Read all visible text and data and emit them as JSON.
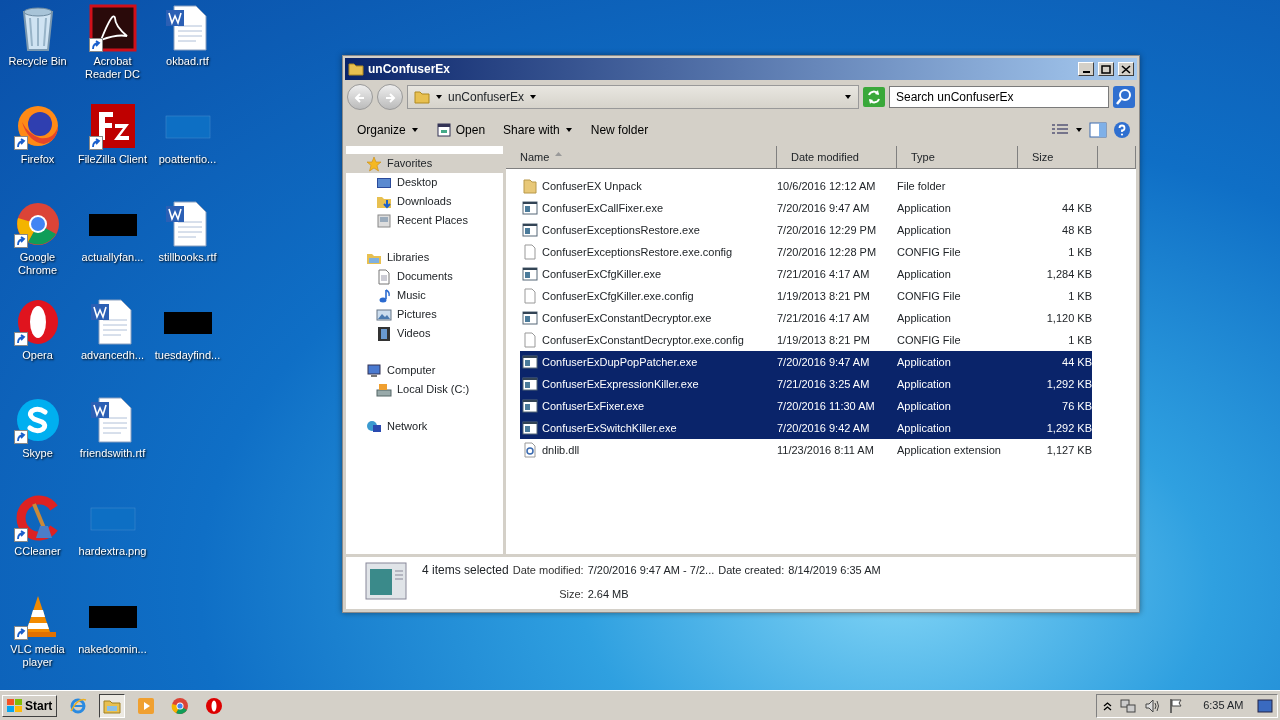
{
  "desktop": {
    "icons": [
      {
        "label": "Recycle Bin",
        "kind": "recycle",
        "shortcut": false
      },
      {
        "label": "Firefox",
        "kind": "firefox",
        "shortcut": true
      },
      {
        "label": "Google Chrome",
        "kind": "chrome",
        "shortcut": true
      },
      {
        "label": "Opera",
        "kind": "opera",
        "shortcut": true
      },
      {
        "label": "Skype",
        "kind": "skype",
        "shortcut": true
      },
      {
        "label": "CCleaner",
        "kind": "ccleaner",
        "shortcut": true
      },
      {
        "label": "VLC media player",
        "kind": "vlc",
        "shortcut": true
      },
      {
        "label": "Acrobat Reader DC",
        "kind": "acrobat",
        "shortcut": true
      },
      {
        "label": "FileZilla Client",
        "kind": "filezilla",
        "shortcut": true
      },
      {
        "label": "actuallyfan...",
        "kind": "dark-thumb",
        "shortcut": false
      },
      {
        "label": "advancedh...",
        "kind": "word",
        "shortcut": false
      },
      {
        "label": "friendswith.rtf",
        "kind": "word",
        "shortcut": false
      },
      {
        "label": "hardextra.png",
        "kind": "blank-thumb",
        "shortcut": false
      },
      {
        "label": "nakedcomin...",
        "kind": "dark-thumb",
        "shortcut": false
      },
      {
        "label": "okbad.rtf",
        "kind": "word",
        "shortcut": false
      },
      {
        "label": "poattentio...",
        "kind": "blank-thumb",
        "shortcut": false
      },
      {
        "label": "stillbooks.rtf",
        "kind": "word",
        "shortcut": false
      },
      {
        "label": "tuesdayfind...",
        "kind": "dark-thumb",
        "shortcut": false
      }
    ]
  },
  "window": {
    "title": "unConfuserEx",
    "address": "unConfuserEx",
    "search": {
      "placeholder": "Search unConfuserEx"
    },
    "toolbar": [
      {
        "label": "Organize",
        "kind": "menu"
      },
      {
        "label": "Open",
        "kind": "open"
      },
      {
        "label": "Share with",
        "kind": "menu"
      },
      {
        "label": "New folder",
        "kind": "plain"
      }
    ],
    "sidebar": [
      {
        "label": "Favorites",
        "kind": "star",
        "selected": true,
        "children": [
          {
            "label": "Desktop",
            "kind": "desktop",
            "selected": false
          },
          {
            "label": "Downloads",
            "kind": "downloads",
            "selected": false
          },
          {
            "label": "Recent Places",
            "kind": "recent",
            "selected": false
          }
        ]
      },
      {
        "label": "Libraries",
        "kind": "library",
        "selected": false,
        "children": [
          {
            "label": "Documents",
            "kind": "document",
            "selected": false
          },
          {
            "label": "Music",
            "kind": "music",
            "selected": false
          },
          {
            "label": "Pictures",
            "kind": "pictures",
            "selected": false
          },
          {
            "label": "Videos",
            "kind": "videos",
            "selected": false
          }
        ]
      },
      {
        "label": "Computer",
        "kind": "computer",
        "selected": false,
        "children": [
          {
            "label": "Local Disk (C:)",
            "kind": "disk",
            "selected": false
          }
        ]
      },
      {
        "label": "Network",
        "kind": "network",
        "selected": false
      }
    ],
    "columns": [
      {
        "label": "Name",
        "sorted": true
      },
      {
        "label": "Date modified",
        "sorted": false
      },
      {
        "label": "Type",
        "sorted": false
      },
      {
        "label": "Size",
        "sorted": false
      }
    ],
    "files": [
      {
        "name": "ConfuserEX Unpack",
        "date": "10/6/2016 12:12 AM",
        "type": "File folder",
        "kind": "folder",
        "selected": false
      },
      {
        "name": "ConfuserExCallFixer.exe",
        "date": "7/20/2016 9:47 AM",
        "type": "Application",
        "size": "44 KB",
        "kind": "exe",
        "selected": false
      },
      {
        "name": "ConfuserExceptionsRestore.exe",
        "date": "7/20/2016 12:29 PM",
        "type": "Application",
        "size": "48 KB",
        "kind": "exe",
        "selected": false
      },
      {
        "name": "ConfuserExceptionsRestore.exe.config",
        "date": "7/20/2016 12:28 PM",
        "type": "CONFIG File",
        "size": "1 KB",
        "kind": "config",
        "selected": false
      },
      {
        "name": "ConfuserExCfgKiller.exe",
        "date": "7/21/2016 4:17 AM",
        "type": "Application",
        "size": "1,284 KB",
        "kind": "exe",
        "selected": false
      },
      {
        "name": "ConfuserExCfgKiller.exe.config",
        "date": "1/19/2013 8:21 PM",
        "type": "CONFIG File",
        "size": "1 KB",
        "kind": "config",
        "selected": false
      },
      {
        "name": "ConfuserExConstantDecryptor.exe",
        "date": "7/21/2016 4:17 AM",
        "type": "Application",
        "size": "1,120 KB",
        "kind": "exe",
        "selected": false
      },
      {
        "name": "ConfuserExConstantDecryptor.exe.config",
        "date": "1/19/2013 8:21 PM",
        "type": "CONFIG File",
        "size": "1 KB",
        "kind": "config",
        "selected": false
      },
      {
        "name": "ConfuserExDupPopPatcher.exe",
        "date": "7/20/2016 9:47 AM",
        "type": "Application",
        "size": "44 KB",
        "kind": "exe",
        "selected": true
      },
      {
        "name": "ConfuserExExpressionKiller.exe",
        "date": "7/21/2016 3:25 AM",
        "type": "Application",
        "size": "1,292 KB",
        "kind": "exe",
        "selected": true
      },
      {
        "name": "ConfuserExFixer.exe",
        "date": "7/20/2016 11:30 AM",
        "type": "Application",
        "size": "76 KB",
        "kind": "exe",
        "selected": true
      },
      {
        "name": "ConfuserExSwitchKiller.exe",
        "date": "7/20/2016 9:42 AM",
        "type": "Application",
        "size": "1,292 KB",
        "kind": "exe",
        "selected": true
      },
      {
        "name": "dnlib.dll",
        "date": "11/23/2016 8:11 AM",
        "type": "Application extension",
        "size": "1,127 KB",
        "kind": "dll",
        "selected": false
      }
    ],
    "details": {
      "summary": "4 items selected",
      "fields": [
        {
          "label": "Date modified:",
          "value": "7/20/2016 9:47 AM - 7/2..."
        },
        {
          "label": "Date created:",
          "value": "8/14/2019 6:35 AM"
        },
        {
          "label": "Size:",
          "value": "2.64 MB"
        }
      ]
    }
  },
  "taskbar": {
    "start": "Start",
    "apps": [
      {
        "kind": "ie",
        "selected": false
      },
      {
        "kind": "explorer",
        "selected": true
      },
      {
        "kind": "media",
        "selected": false
      },
      {
        "kind": "chrome",
        "selected": false
      },
      {
        "kind": "opera",
        "selected": false
      }
    ],
    "clock": "6:35 AM"
  }
}
